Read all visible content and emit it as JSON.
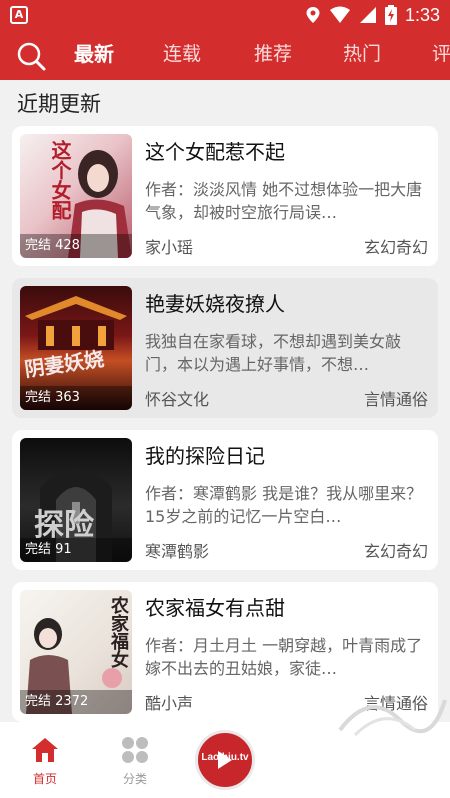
{
  "status_bar": {
    "time": "1:33",
    "app_icon": "A"
  },
  "nav": {
    "tabs": [
      {
        "label": "最新",
        "active": true
      },
      {
        "label": "连载"
      },
      {
        "label": "推荐"
      },
      {
        "label": "热门"
      },
      {
        "label": "评"
      }
    ]
  },
  "section_title": "近期更新",
  "books": [
    {
      "title": "这个女配惹不起",
      "desc": "作者：淡淡风情 她不过想体验一把大唐气象，却被时空旅行局误…",
      "author": "家小瑶",
      "genre": "玄幻奇幻",
      "badge": "完结 428",
      "cover_text": "这个女配惹不起"
    },
    {
      "title": "艳妻妖娆夜撩人",
      "desc": "我独自在家看球，不想却遇到美女敲门，本以为遇上好事情，不想…",
      "author": "怀谷文化",
      "genre": "言情通俗",
      "badge": "完结 363",
      "cover_text": "阴妻妖娆夜撩人"
    },
    {
      "title": "我的探险日记",
      "desc": "作者：寒潭鹤影 我是谁？我从哪里来？15岁之前的记忆一片空白…",
      "author": "寒潭鹤影",
      "genre": "玄幻奇幻",
      "badge": "完结 91",
      "cover_text": "探险"
    },
    {
      "title": "农家福女有点甜",
      "desc": "作者：月土月土 一朝穿越，叶青雨成了嫁不出去的丑姑娘，家徒…",
      "author": "酷小声",
      "genre": "言情通俗",
      "badge": "完结 2372",
      "cover_text": "农家福女"
    }
  ],
  "bottom_nav": [
    {
      "label": "首页",
      "active": true
    },
    {
      "label": "分类"
    }
  ],
  "fab_text": "Laolbiu.tv",
  "colors": {
    "brand": "#d32d2d",
    "active_tab": "#d32d2d",
    "text": "#111111"
  }
}
